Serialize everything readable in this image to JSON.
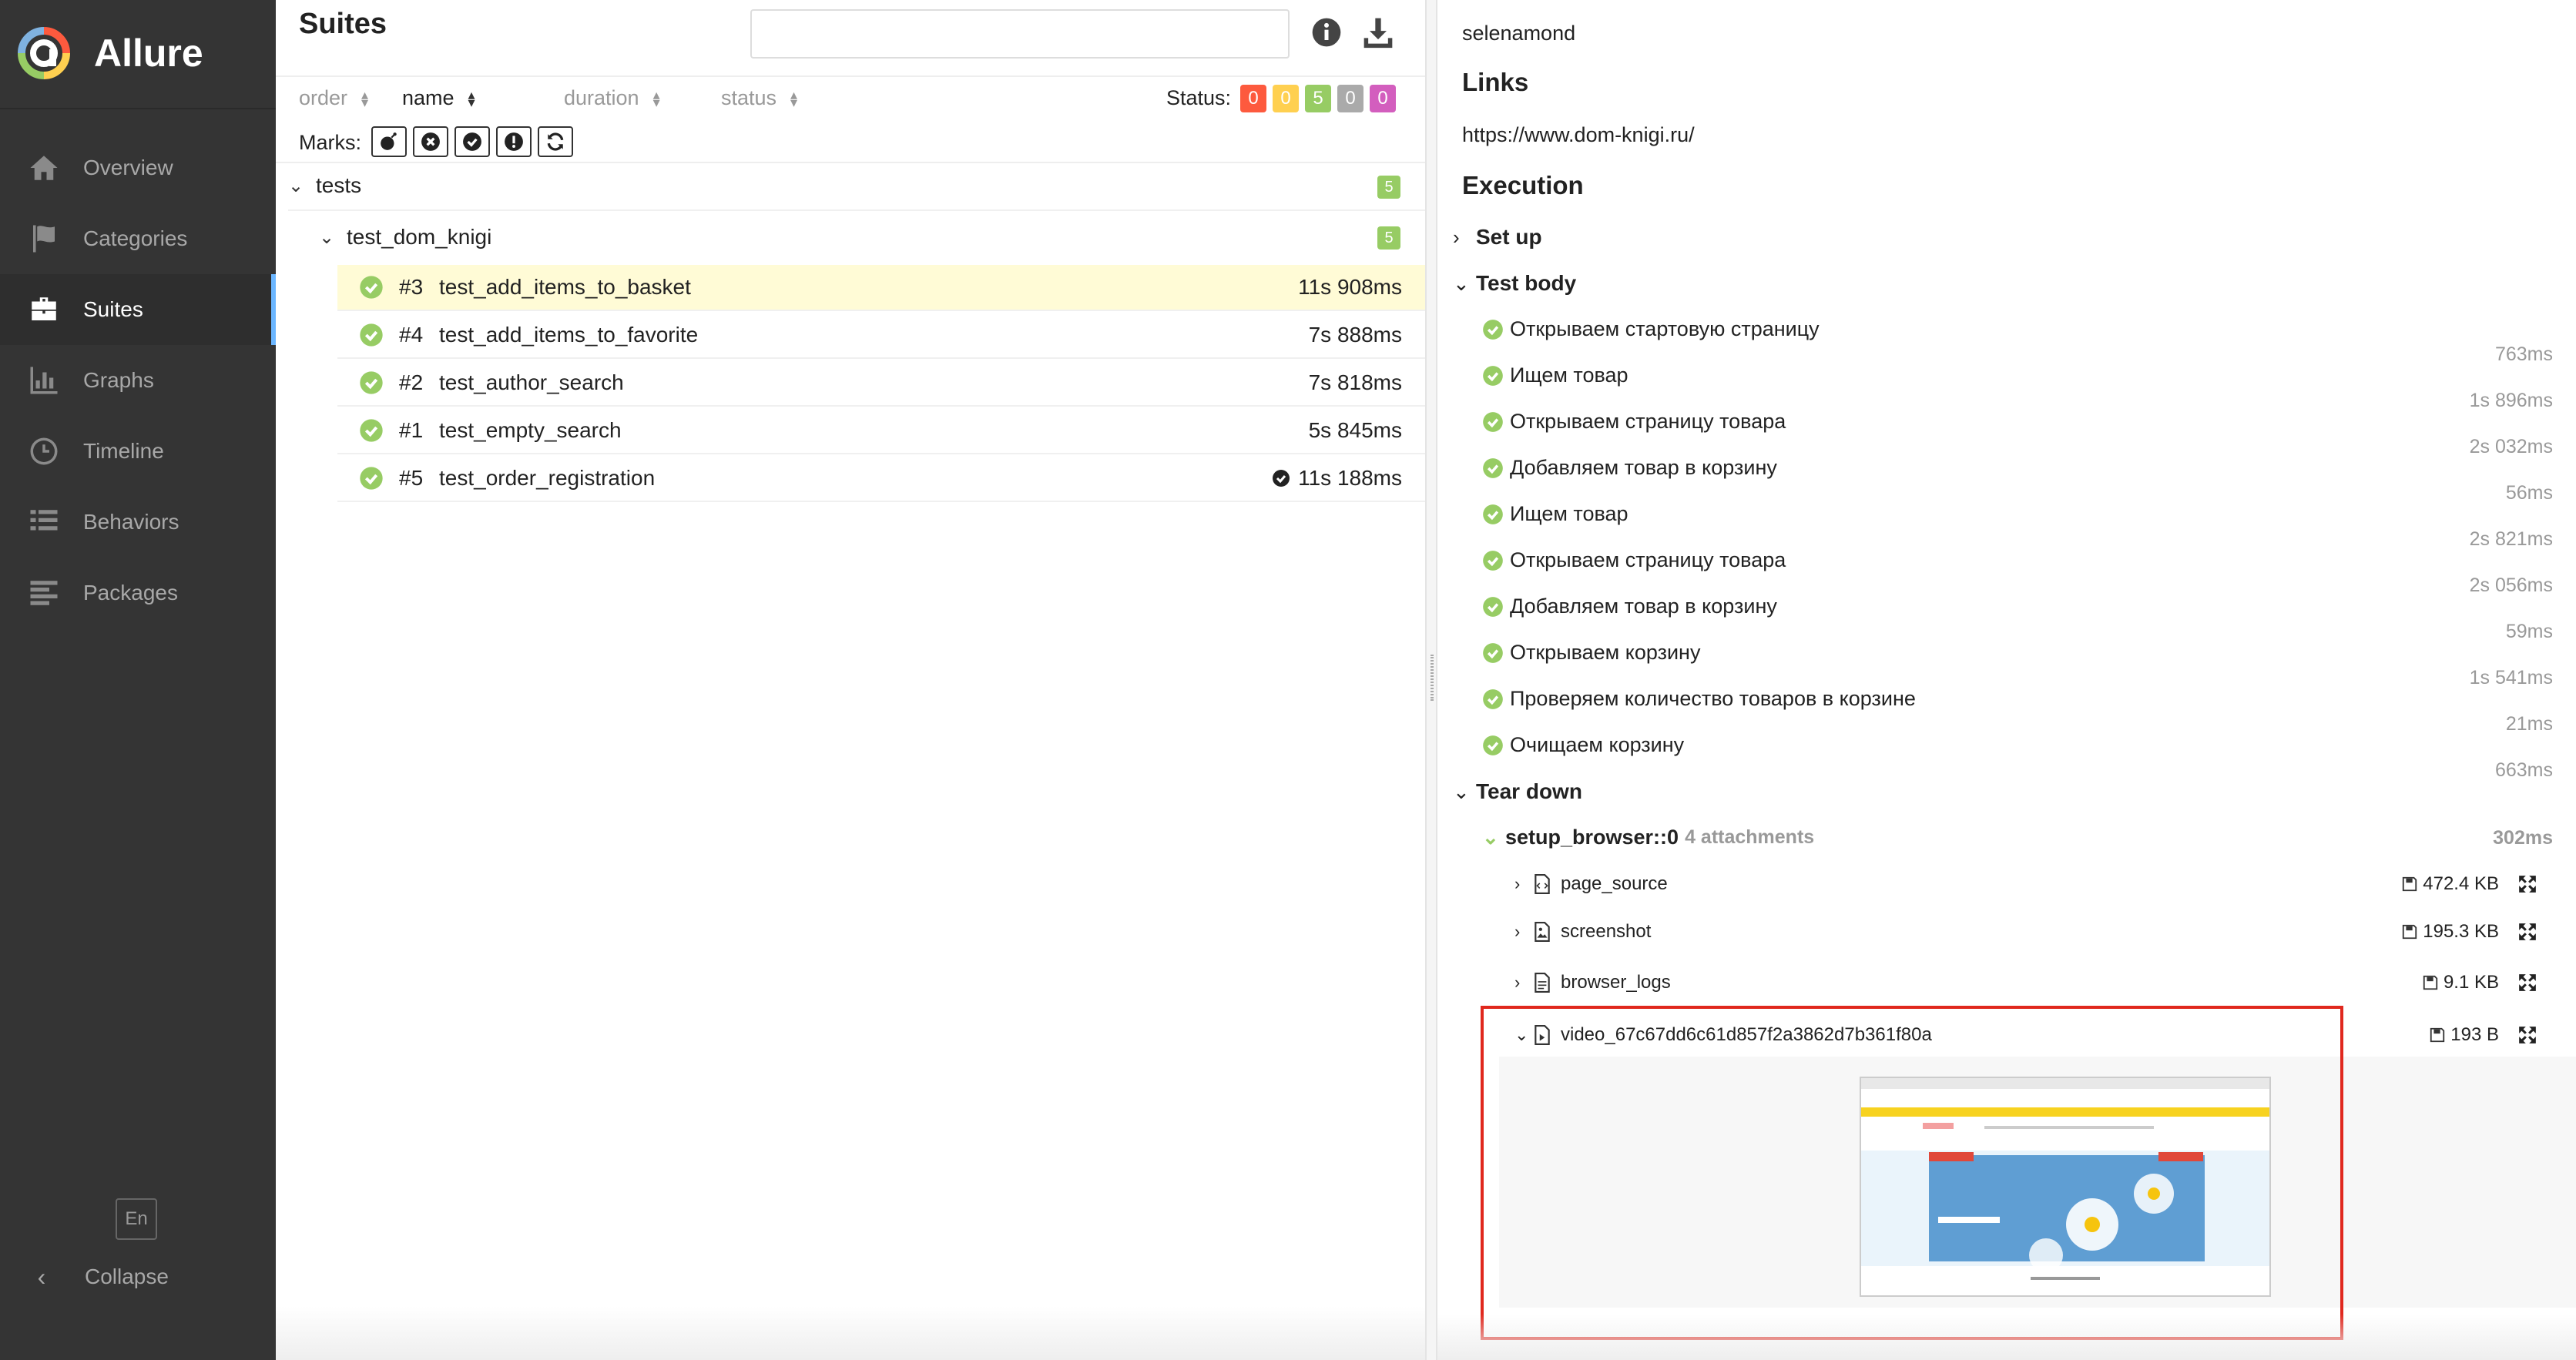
{
  "app": {
    "name": "Allure"
  },
  "sidebar": {
    "items": [
      {
        "label": "Overview",
        "icon": "home-icon"
      },
      {
        "label": "Categories",
        "icon": "flag-icon"
      },
      {
        "label": "Suites",
        "icon": "briefcase-icon",
        "active": true
      },
      {
        "label": "Graphs",
        "icon": "bar-chart-icon"
      },
      {
        "label": "Timeline",
        "icon": "clock-icon"
      },
      {
        "label": "Behaviors",
        "icon": "list-icon"
      },
      {
        "label": "Packages",
        "icon": "align-left-icon"
      }
    ],
    "language": "En",
    "collapse_label": "Collapse"
  },
  "suites": {
    "title": "Suites",
    "search": {
      "value": "",
      "placeholder": ""
    },
    "sort": {
      "order": "order",
      "name": "name",
      "duration": "duration",
      "status": "status"
    },
    "status_label": "Status:",
    "status_counts": [
      {
        "value": "0",
        "color": "#fd5a3e"
      },
      {
        "value": "0",
        "color": "#ffd050"
      },
      {
        "value": "5",
        "color": "#97cc64"
      },
      {
        "value": "0",
        "color": "#aaaaaa"
      },
      {
        "value": "0",
        "color": "#d35ebe"
      }
    ],
    "marks_label": "Marks:",
    "groups": [
      {
        "label": "tests",
        "count": "5"
      },
      {
        "label": "test_dom_knigi",
        "count": "5"
      }
    ],
    "tests": [
      {
        "num": "#3",
        "name": "test_add_items_to_basket",
        "duration": "11s 908ms",
        "selected": true
      },
      {
        "num": "#4",
        "name": "test_add_items_to_favorite",
        "duration": "7s 888ms"
      },
      {
        "num": "#2",
        "name": "test_author_search",
        "duration": "7s 818ms"
      },
      {
        "num": "#1",
        "name": "test_empty_search",
        "duration": "5s 845ms"
      },
      {
        "num": "#5",
        "name": "test_order_registration",
        "duration": "11s 188ms"
      }
    ]
  },
  "detail": {
    "owner": "selenamond",
    "links_title": "Links",
    "link": "https://www.dom-knigi.ru/",
    "execution_title": "Execution",
    "setup_label": "Set up",
    "test_body_label": "Test body",
    "steps": [
      {
        "label": "Открываем стартовую страницу",
        "duration": "763ms"
      },
      {
        "label": "Ищем товар",
        "duration": "1s 896ms"
      },
      {
        "label": "Открываем страницу товара",
        "duration": "2s 032ms"
      },
      {
        "label": "Добавляем товар в корзину",
        "duration": "56ms"
      },
      {
        "label": "Ищем товар",
        "duration": "2s 821ms"
      },
      {
        "label": "Открываем страницу товара",
        "duration": "2s 056ms"
      },
      {
        "label": "Добавляем товар в корзину",
        "duration": "59ms"
      },
      {
        "label": "Открываем корзину",
        "duration": "1s 541ms"
      },
      {
        "label": "Проверяем количество товаров в корзине",
        "duration": "21ms"
      },
      {
        "label": "Очищаем корзину",
        "duration": "663ms"
      }
    ],
    "teardown_label": "Tear down",
    "fixture": {
      "name": "setup_browser::0",
      "attachments": "4 attachments",
      "duration": "302ms"
    },
    "attachments": [
      {
        "name": "page_source",
        "size": "472.4 KB"
      },
      {
        "name": "screenshot",
        "size": "195.3 KB"
      },
      {
        "name": "browser_logs",
        "size": "9.1 KB"
      },
      {
        "name": "video_67c67dd6c61d857f2a3862d7b361f80a",
        "size": "193 B"
      }
    ]
  }
}
